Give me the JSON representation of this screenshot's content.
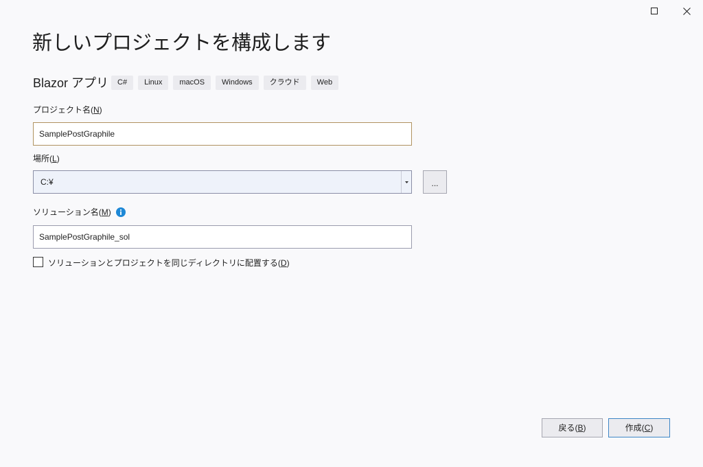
{
  "colors": {
    "background": "#f9f9fb",
    "text": "#1e1e1e",
    "tag_background": "#ebebef",
    "focused_input_border": "#b0925f",
    "input_border": "#9a9bad",
    "combo_border": "#8a8ea6",
    "combo_background": "#eef2fa",
    "button_background": "#ebebef",
    "button_border": "#a5a6b0",
    "default_button_border": "#3d86c6",
    "info_icon": "#1e88d6"
  },
  "window_controls": {
    "maximize_icon": "maximize-icon",
    "close_icon": "close-icon"
  },
  "header": {
    "title": "新しいプロジェクトを構成します",
    "template_name": "Blazor アプリ",
    "tags": [
      "C#",
      "Linux",
      "macOS",
      "Windows",
      "クラウド",
      "Web"
    ]
  },
  "form": {
    "project_name": {
      "label": "プロジェクト名(",
      "access_key": "N",
      "label_end": ")",
      "value": "SamplePostGraphile"
    },
    "location": {
      "label": "場所(",
      "access_key": "L",
      "label_end": ")",
      "value": "C:¥",
      "dropdown_icon": "chevron-down-icon",
      "browse_label": "..."
    },
    "solution_name": {
      "label": "ソリューション名(",
      "access_key": "M",
      "label_end": ")",
      "info_icon": "info-icon",
      "value": "SamplePostGraphile_sol"
    },
    "same_directory": {
      "label": "ソリューションとプロジェクトを同じディレクトリに配置する(",
      "access_key": "D",
      "label_end": ")",
      "checked": false
    }
  },
  "footer": {
    "back_button": {
      "label": "戻る(",
      "access_key": "B",
      "label_end": ")"
    },
    "create_button": {
      "label": "作成(",
      "access_key": "C",
      "label_end": ")"
    }
  }
}
